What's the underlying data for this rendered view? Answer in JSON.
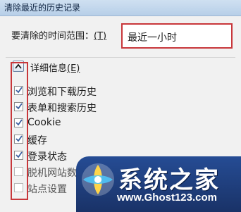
{
  "window": {
    "title": "清除最近的历史记录"
  },
  "time_range": {
    "label": "要清除的时间范围：",
    "accesskey": "(T)",
    "selected": "最近一小时"
  },
  "details": {
    "label": "详细信息",
    "accesskey": "(E)"
  },
  "items": [
    {
      "label": "浏览和下载历史",
      "checked": true
    },
    {
      "label": "表单和搜索历史",
      "checked": true
    },
    {
      "label": "Cookie",
      "checked": true
    },
    {
      "label": "缓存",
      "checked": true
    },
    {
      "label": "登录状态",
      "checked": true
    },
    {
      "label": "脱机网站数",
      "checked": false
    },
    {
      "label": "站点设置",
      "checked": false
    }
  ],
  "watermark": {
    "name": "系统之家",
    "url": "www.Ghost123.com"
  },
  "colors": {
    "highlight": "#c8373b",
    "checkmark": "#3b5f9e"
  }
}
